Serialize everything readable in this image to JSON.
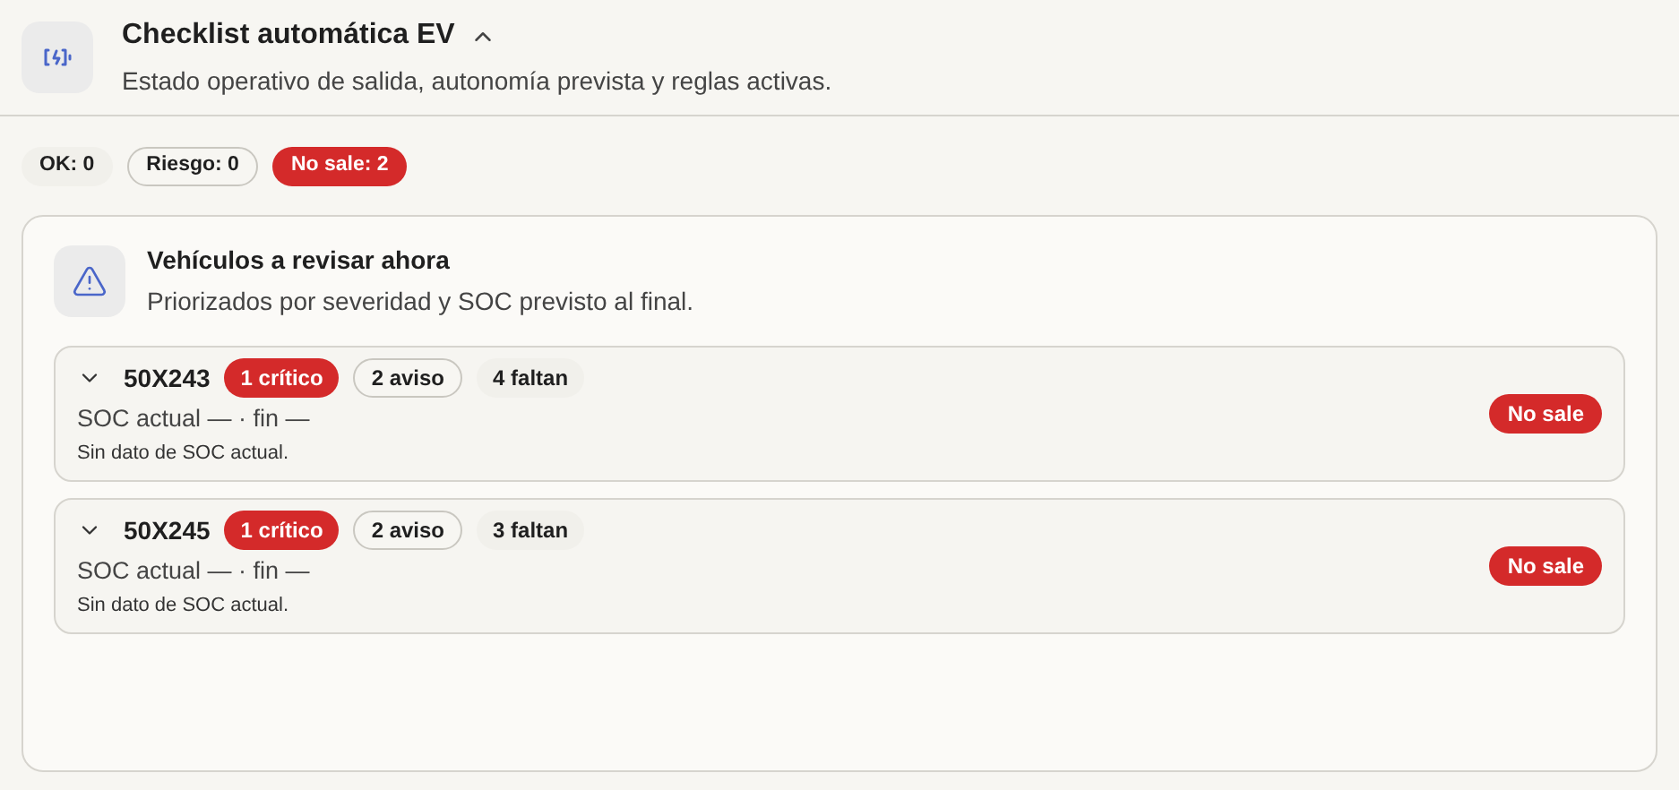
{
  "header": {
    "title": "Checklist automática EV",
    "subtitle": "Estado operativo de salida, autonomía prevista y reglas activas.",
    "expanded": true
  },
  "summary": [
    {
      "label": "OK: 0",
      "kind": "plain"
    },
    {
      "label": "Riesgo: 0",
      "kind": "outline"
    },
    {
      "label": "No sale: 2",
      "kind": "danger"
    }
  ],
  "panel": {
    "title": "Vehículos a revisar ahora",
    "subtitle": "Priorizados por severidad y SOC previsto al final.",
    "vehicles": [
      {
        "id": "50X243",
        "expanded": false,
        "badges": [
          {
            "label": "1 crítico",
            "kind": "danger"
          },
          {
            "label": "2 aviso",
            "kind": "outline"
          },
          {
            "label": "4 faltan",
            "kind": "plain"
          }
        ],
        "soc": "SOC actual — · fin —",
        "note": "Sin dato de SOC actual.",
        "status": "No sale"
      },
      {
        "id": "50X245",
        "expanded": false,
        "badges": [
          {
            "label": "1 crítico",
            "kind": "danger"
          },
          {
            "label": "2 aviso",
            "kind": "outline"
          },
          {
            "label": "3 faltan",
            "kind": "plain"
          }
        ],
        "soc": "SOC actual — · fin —",
        "note": "Sin dato de SOC actual.",
        "status": "No sale"
      }
    ]
  }
}
